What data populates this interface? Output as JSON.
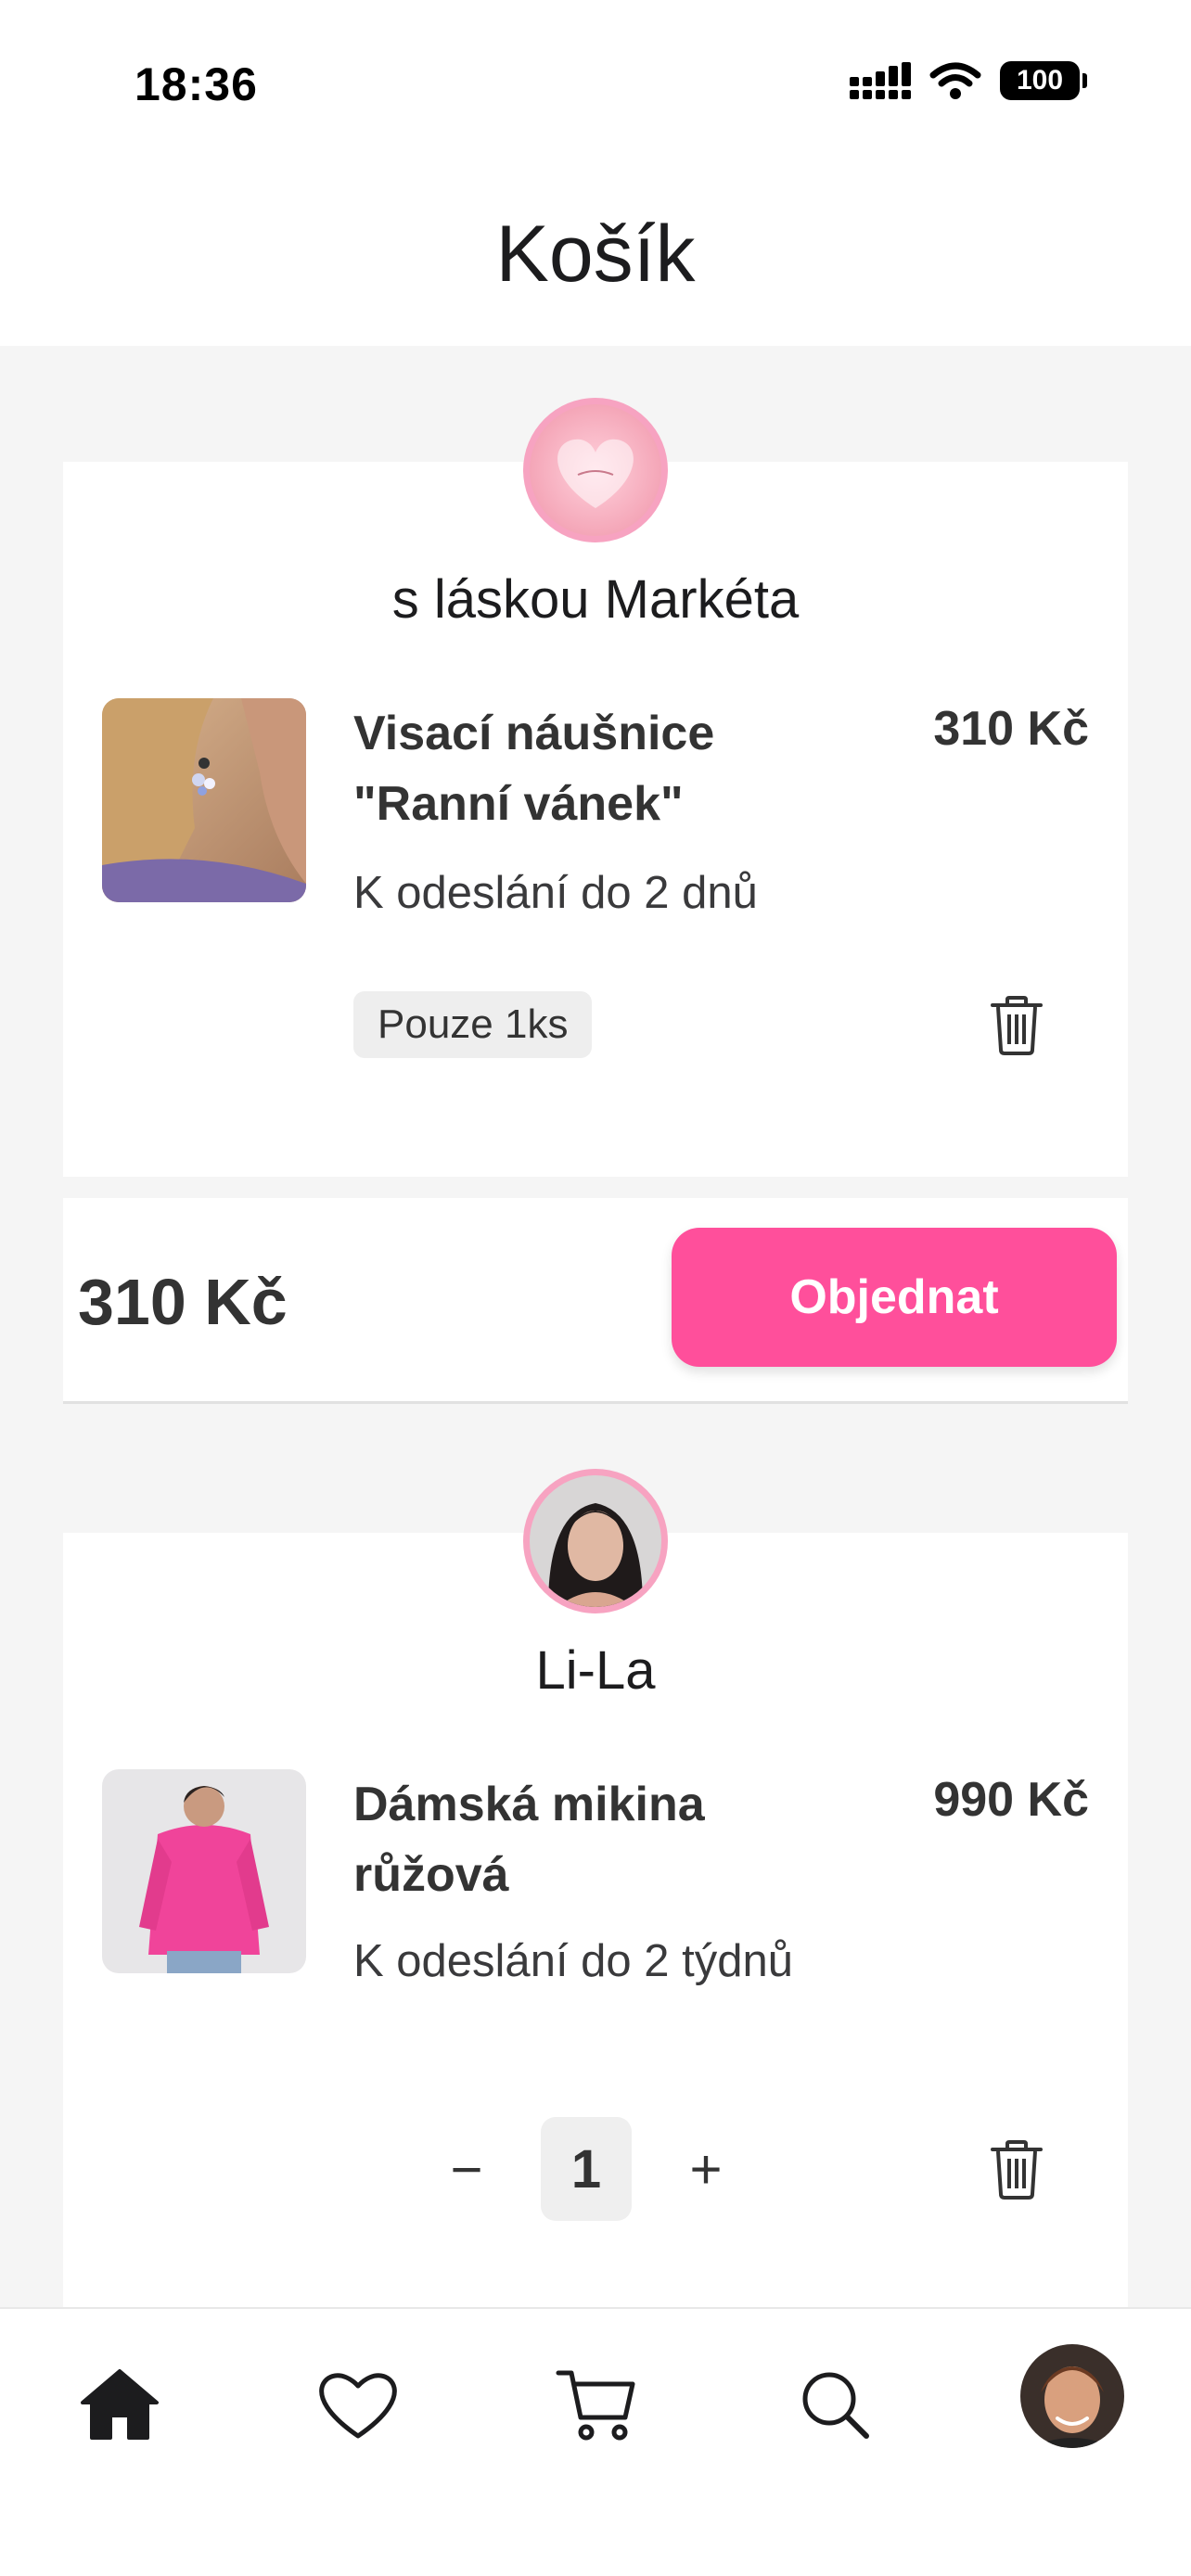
{
  "status_bar": {
    "time": "18:36",
    "battery": "100"
  },
  "header": {
    "title": "Košík"
  },
  "colors": {
    "accent": "#ff4f9b",
    "avatar_ring": "#f7a3c1",
    "background": "#f5f5f5"
  },
  "shops": [
    {
      "name": "s láskou Markéta",
      "item": {
        "name": "Visací náušnice \"Ranní vánek\"",
        "price": "310 Kč",
        "shipping": "K odeslání do 2 dnů",
        "stock_label": "Pouze 1ks"
      },
      "total": "310 Kč",
      "order_label": "Objednat"
    },
    {
      "name": "Li-La",
      "item": {
        "name": "Dámská mikina růžová",
        "price": "990 Kč",
        "shipping": "K odeslání do 2 týdnů",
        "quantity": "1",
        "decrement": "−",
        "increment": "+"
      }
    }
  ],
  "bottom_nav": {
    "items": [
      "home-icon",
      "heart-icon",
      "cart-icon",
      "search-icon",
      "profile-avatar"
    ]
  }
}
